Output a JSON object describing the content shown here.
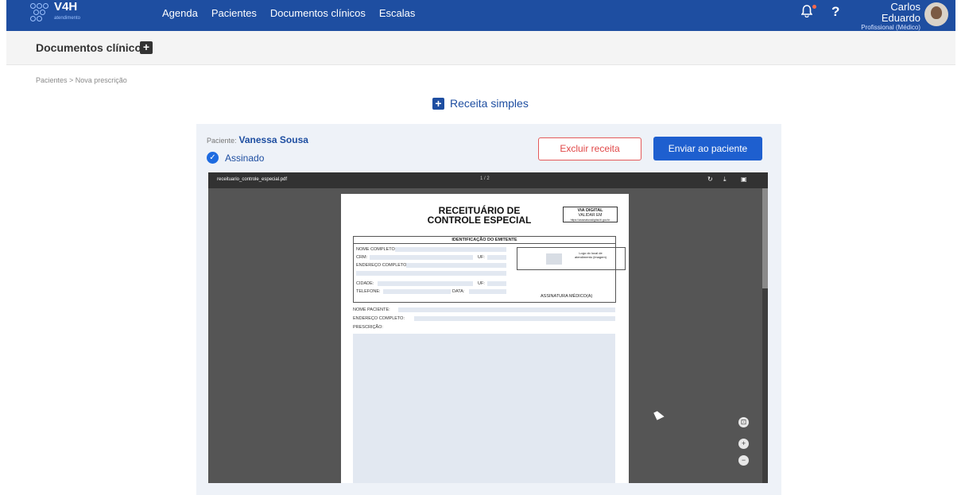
{
  "app": {
    "brand": "V4H",
    "brand_sub": "atendimento",
    "nav": [
      "Agenda",
      "Pacientes",
      "Documentos clínicos",
      "Escalas"
    ],
    "help": "?",
    "user": {
      "name": "Carlos Eduardo",
      "role": "Profissional (Médico)"
    },
    "colors": {
      "primary": "#1e4ea1",
      "danger": "#e14848",
      "notification": "#ff6a4a"
    }
  },
  "subheader": {
    "title": "Documentos clínicos",
    "add": "+"
  },
  "breadcrumb": "Pacientes  >  Nova prescrição",
  "page_title": {
    "icon": "+",
    "text": "Receita simples"
  },
  "card": {
    "patient_label": "Paciente:",
    "patient_name": "Vanessa Sousa",
    "signed_label": "Assinado",
    "delete_button": "Excluir receita",
    "send_button": "Enviar ao paciente"
  },
  "viewer": {
    "filename": "receituario_controle_especial.pdf",
    "pages": "1 / 2",
    "icons": [
      "rotate-icon",
      "download-icon",
      "print-icon"
    ],
    "controls": [
      "fit-icon",
      "zoom-in-icon",
      "zoom-out-icon"
    ]
  },
  "document": {
    "title_line1": "RECEITUÁRIO DE",
    "title_line2": "CONTROLE ESPECIAL",
    "via_title": "VIA DIGITAL",
    "via_line1": "VALIDAR EM",
    "via_line2": "https://assinaturadigital.iti.gov.br",
    "emitter_header": "IDENTIFICAÇÃO DO EMITENTE",
    "nome_completo": "NOME COMPLETO:",
    "crm": "CRM:",
    "uf": "UF:",
    "endereco": "ENDEREÇO COMPLETO:",
    "cidade": "CIDADE:",
    "telefone": "TELEFONE:",
    "data": "DATA:",
    "logo_text": "Logo do local de atendimento (imagem)",
    "assinatura": "ASSINATURA MÉDICO(A)",
    "nome_paciente": "NOME PACIENTE:",
    "endereco_paciente": "ENDEREÇO COMPLETO:",
    "prescricao": "PRESCRIÇÃO:"
  }
}
